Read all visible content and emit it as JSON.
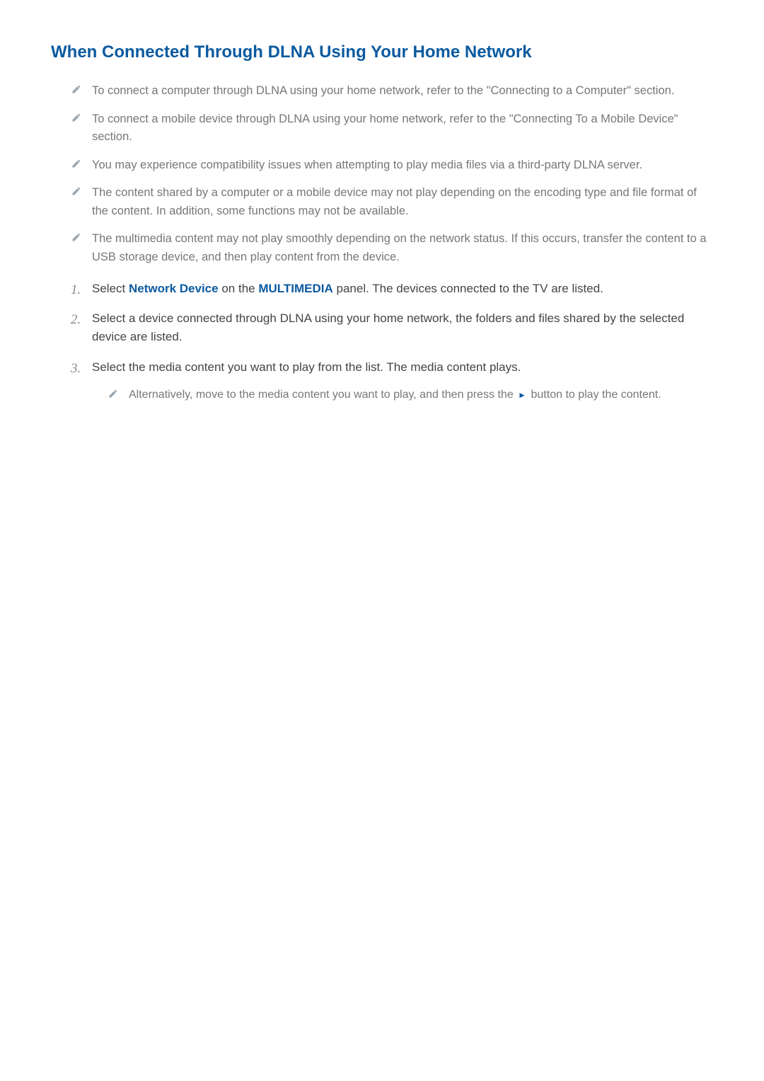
{
  "heading": "When Connected Through DLNA Using Your Home Network",
  "notes": [
    "To connect a computer through DLNA using your home network, refer to the \"Connecting to a Computer\" section.",
    "To connect a mobile device through DLNA using your home network, refer to the \"Connecting To a Mobile Device\" section.",
    "You may experience compatibility issues when attempting to play media files via a third-party DLNA server.",
    "The content shared by a computer or a mobile device may not play depending on the encoding type and file format of the content. In addition, some functions may not be available.",
    "The multimedia content may not play smoothly depending on the network status. If this occurs, transfer the content to a USB storage device, and then play content from the device."
  ],
  "steps": [
    {
      "prefix": "Select ",
      "hl1": "Network Device",
      "mid": " on the ",
      "hl2": "MULTIMEDIA",
      "suffix": " panel. The devices connected to the TV are listed."
    },
    {
      "plain": "Select a device connected through DLNA using your home network, the folders and files shared by the selected device are listed."
    },
    {
      "plain": "Select the media content you want to play from the list. The media content plays.",
      "subnote_prefix": "Alternatively, move to the media content you want to play, and then press the ",
      "subnote_suffix": " button to play the content."
    }
  ],
  "icons": {
    "play_glyph": "►"
  }
}
